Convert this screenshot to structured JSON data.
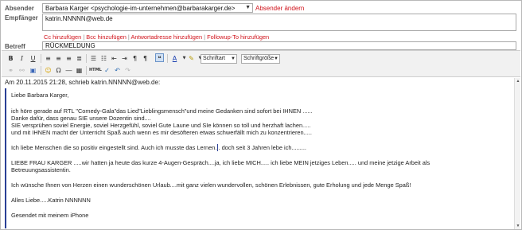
{
  "from": {
    "label": "Absender",
    "value": "Barbara Karger <psychologie-im-unternehmen@barbarakarger.de>",
    "change_link": "Absender ändern"
  },
  "to": {
    "label": "Empfänger",
    "value": "katrin.NNNNN@web.de"
  },
  "add_links": [
    "Cc hinzufügen",
    "Bcc hinzufügen",
    "Antwortadresse hinzufügen",
    "Followup-To hinzufügen"
  ],
  "subject": {
    "label": "Betreff",
    "value": "RÜCKMELDUNG"
  },
  "toolbar": {
    "font_label": "Schriftart",
    "size_label": "Schriftgröße"
  },
  "quote_header": "Am 20.11.2015 21:28, schrieb katrin.NNNNN@web.de:",
  "body_lines": [
    "Liebe Barbara Karger,",
    "",
    "ich höre gerade auf RTL \"Comedy-Gala\"das Lied\"Lieblingsmensch\"und meine Gedanken sind sofort bei IHNEN ......",
    "Danke dafür, dass genau SIE unsere Dozentin sind....",
    "SIE versprühen soviel Energie, soviel Herzgefühl, soviel Gute Laune und SIe können so toll und herzhaft lachen.....",
    "und mit IHNEN macht der Unterricht Spaß auch wenn es mir desöfteren etwas schwerfällt mich zu konzentrieren.....",
    "",
    "Ich liebe Menschen die so positiv eingestellt sind. Auch ich musste das Lernen... doch seit 3 Jahren lebe ich.........",
    "",
    "LIEBE FRAU KARGER .....wir hatten ja heute das kurze 4-Augen-Gespräch....ja, ich liebe MICH..... ich liebe MEIN jetziges Leben..... und meine jetzige Arbeit als",
    "Betreuungsassistentin.",
    "",
    "Ich wünsche Ihnen von Herzen einen wunderschönen Urlaub....mit ganz vielen wundervollen, schönen Erlebnissen, gute Erholung und jede Menge Spaß!",
    "",
    "Alles Liebe.....Katrin NNNNNN",
    "",
    "Gesendet mit meinem iPhone"
  ]
}
